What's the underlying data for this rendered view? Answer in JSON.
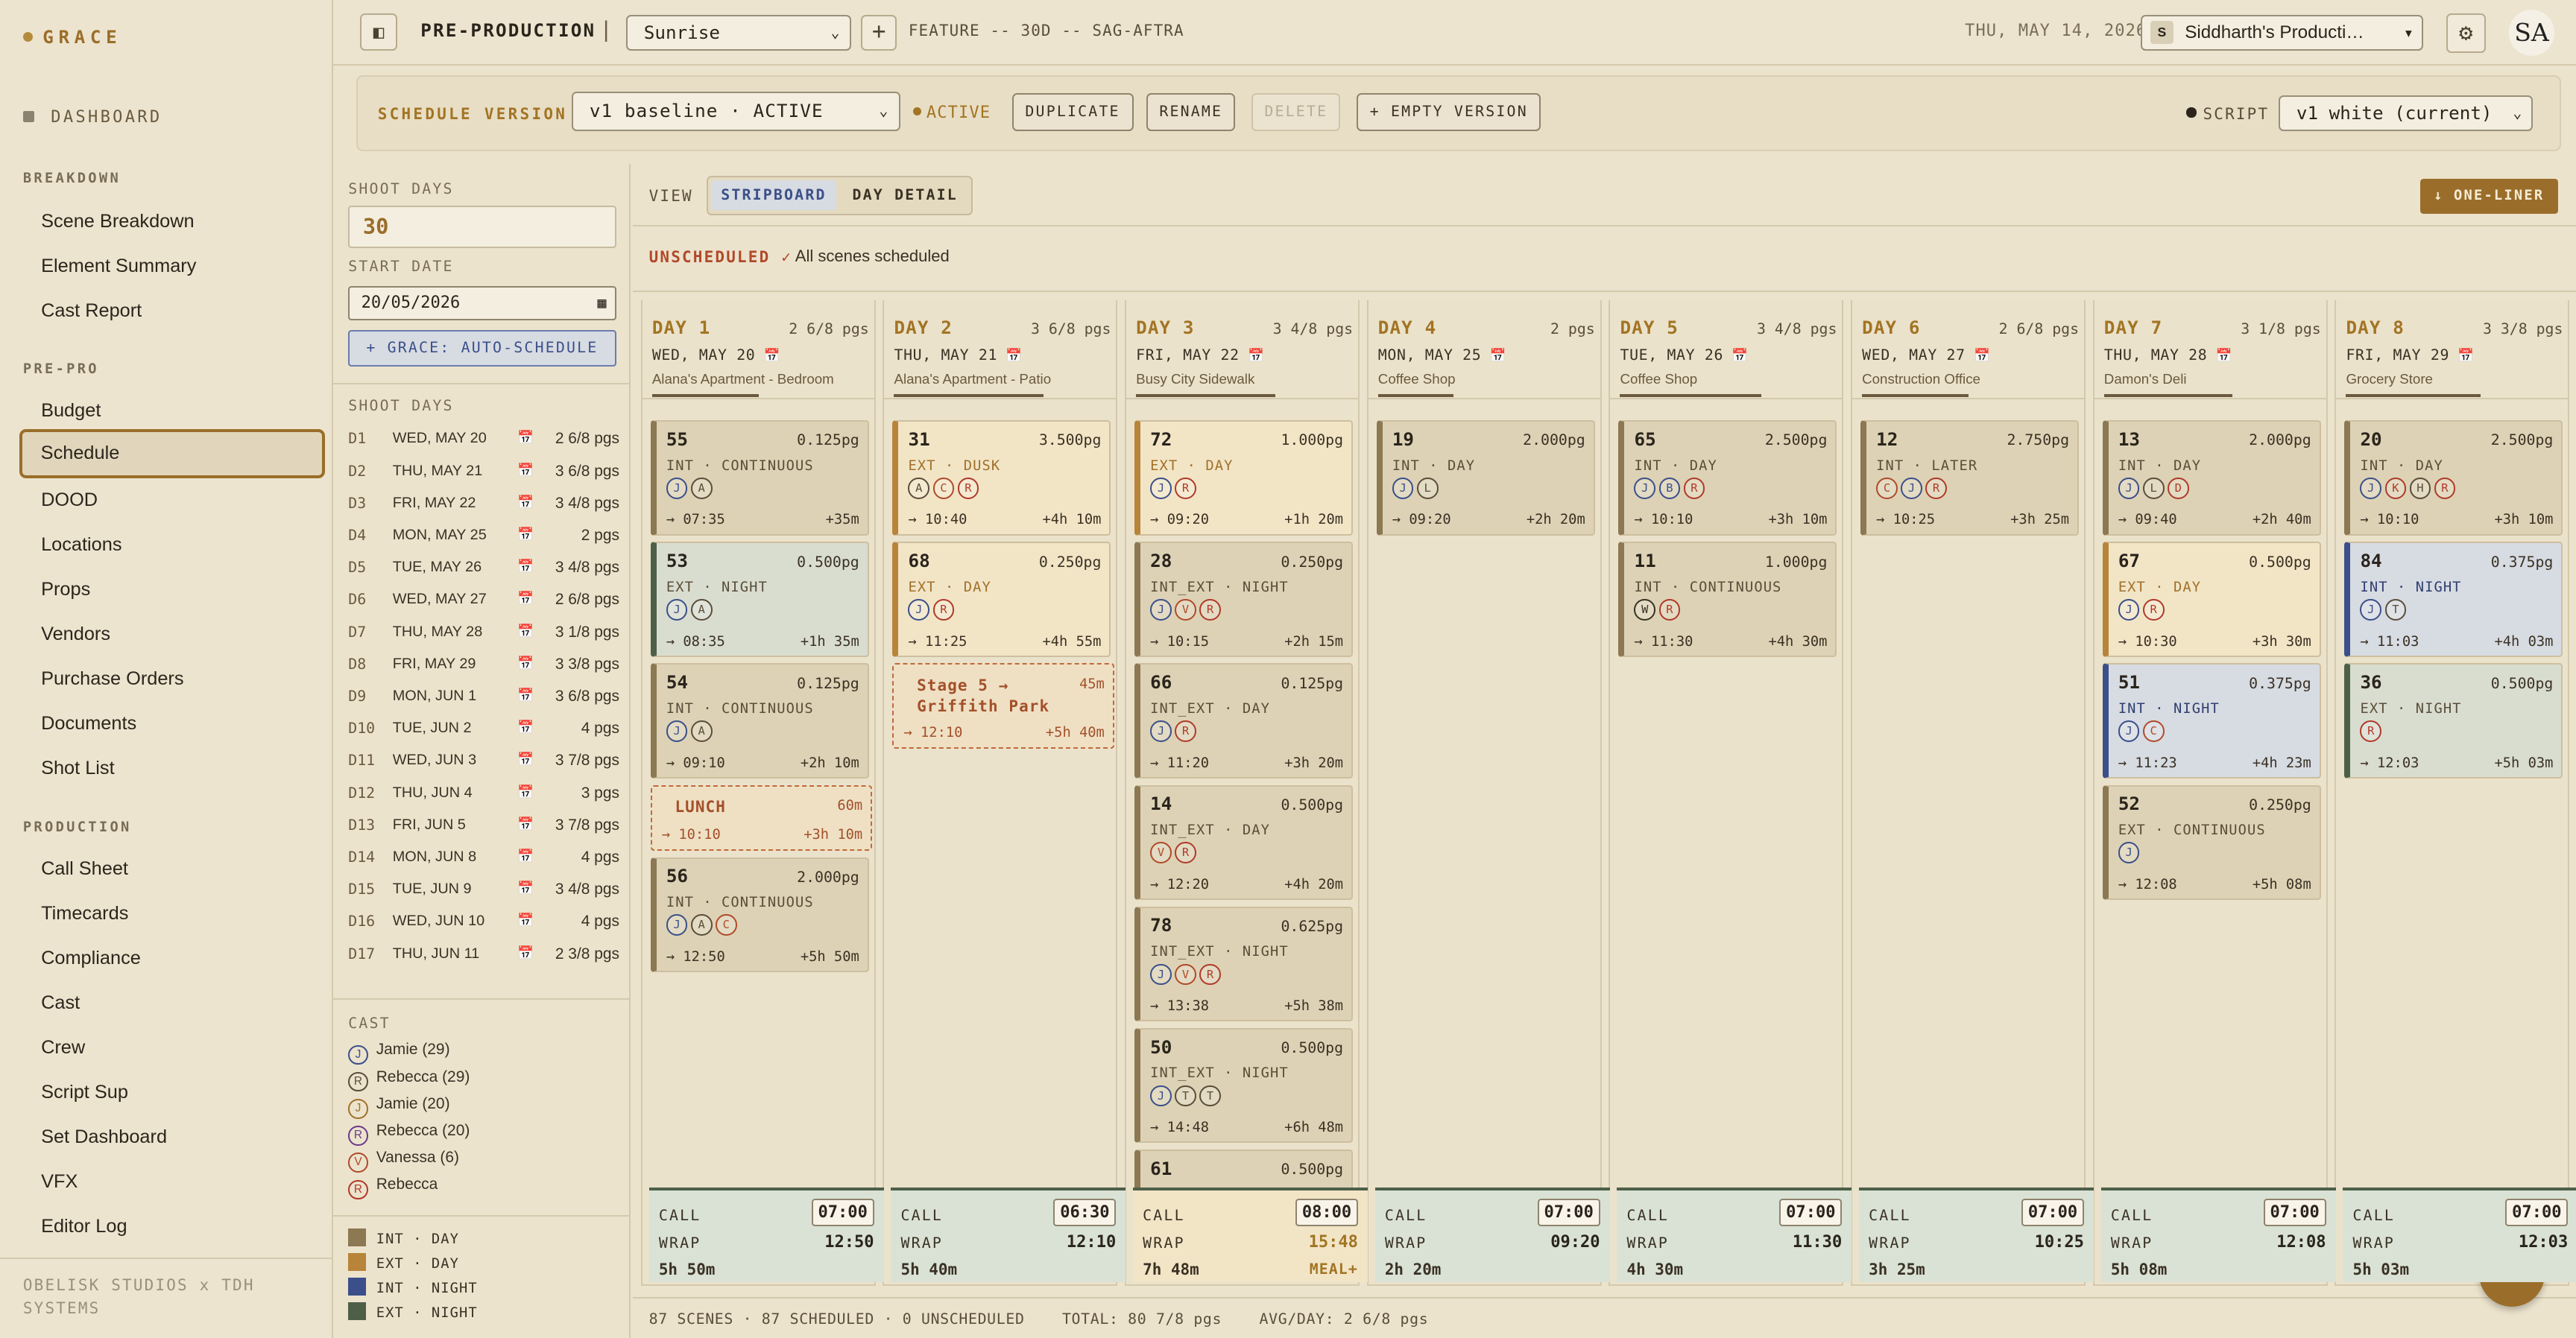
{
  "app": {
    "logo": "GRACE",
    "dashboard": "DASHBOARD",
    "footer": "OBELISK STUDIOS x TDH SYSTEMS"
  },
  "sidebar": {
    "breakdown_title": "BREAKDOWN",
    "breakdown": [
      "Scene Breakdown",
      "Element Summary",
      "Cast Report"
    ],
    "prepro_title": "PRE-PRO",
    "prepro": [
      "Budget",
      "Schedule",
      "DOOD",
      "Locations",
      "Props",
      "Vendors",
      "Purchase Orders",
      "Documents",
      "Shot List"
    ],
    "production_title": "PRODUCTION",
    "production": [
      "Call Sheet",
      "Timecards",
      "Compliance",
      "Cast",
      "Crew",
      "Script Sup",
      "Set Dashboard",
      "VFX",
      "Editor Log"
    ]
  },
  "topbar": {
    "section": "PRE-PRODUCTION",
    "project": "Sunrise",
    "feature": "FEATURE -- 30D -- SAG-AFTRA",
    "date": "THU, MAY 14, 2026",
    "production": "Siddharth's Producti…",
    "production_initial": "S",
    "user": "SA"
  },
  "version": {
    "label": "SCHEDULE VERSION",
    "value": "v1 baseline · ACTIVE",
    "status": "ACTIVE",
    "duplicate": "DUPLICATE",
    "rename": "RENAME",
    "delete": "DELETE",
    "empty": "+ EMPTY VERSION",
    "script_label": "SCRIPT",
    "script_value": "v1 white (current)"
  },
  "left": {
    "shoot_days_label": "SHOOT DAYS",
    "shoot_days": "30",
    "start_date_label": "START DATE",
    "start_date": "20/05/2026",
    "auto": "+ GRACE: AUTO-SCHEDULE",
    "list_title": "SHOOT DAYS",
    "cast_title": "CAST",
    "days": [
      [
        "D1",
        "WED, MAY 20",
        "2 6/8 pgs"
      ],
      [
        "D2",
        "THU, MAY 21",
        "3 6/8 pgs"
      ],
      [
        "D3",
        "FRI, MAY 22",
        "3 4/8 pgs"
      ],
      [
        "D4",
        "MON, MAY 25",
        "2 pgs"
      ],
      [
        "D5",
        "TUE, MAY 26",
        "3 4/8 pgs"
      ],
      [
        "D6",
        "WED, MAY 27",
        "2 6/8 pgs"
      ],
      [
        "D7",
        "THU, MAY 28",
        "3 1/8 pgs"
      ],
      [
        "D8",
        "FRI, MAY 29",
        "3 3/8 pgs"
      ],
      [
        "D9",
        "MON, JUN 1",
        "3 6/8 pgs"
      ],
      [
        "D10",
        "TUE, JUN 2",
        "4 pgs"
      ],
      [
        "D11",
        "WED, JUN 3",
        "3 7/8 pgs"
      ],
      [
        "D12",
        "THU, JUN 4",
        "3 pgs"
      ],
      [
        "D13",
        "FRI, JUN 5",
        "3 7/8 pgs"
      ],
      [
        "D14",
        "MON, JUN 8",
        "4 pgs"
      ],
      [
        "D15",
        "TUE, JUN 9",
        "3 4/8 pgs"
      ],
      [
        "D16",
        "WED, JUN 10",
        "4 pgs"
      ],
      [
        "D17",
        "THU, JUN 11",
        "2 3/8 pgs"
      ]
    ],
    "cast": [
      [
        "J",
        "Jamie (29)",
        "#3b4f8a"
      ],
      [
        "R",
        "Rebecca (29)",
        "#5a4e3a"
      ],
      [
        "J",
        "Jamie (20)",
        "#a0702a"
      ],
      [
        "R",
        "Rebecca (20)",
        "#6a3a8a"
      ],
      [
        "V",
        "Vanessa (6)",
        "#b04a2a"
      ],
      [
        "R",
        "Rebecca",
        "#b03a2a"
      ]
    ],
    "legend": [
      [
        "INT · DAY",
        "#8c7852"
      ],
      [
        "EXT · DAY",
        "#b8843a"
      ],
      [
        "INT · NIGHT",
        "#3b4f8a"
      ],
      [
        "EXT · NIGHT",
        "#4e5f48"
      ]
    ]
  },
  "main": {
    "view_label": "VIEW",
    "tab_strip": "STRIPBOARD",
    "tab_day": "DAY DETAIL",
    "oneliner": "↓ ONE-LINER",
    "unscheduled": "UNSCHEDULED ✓",
    "all_scheduled": "All scenes scheduled",
    "status": "87 SCENES · 87 SCHEDULED · 0 UNSCHEDULED    TOTAL: 80 7/8 pgs    AVG/DAY: 2 6/8 pgs"
  },
  "days": [
    {
      "title": "DAY 1",
      "pages": "2 6/8 pgs",
      "date": "WED, MAY 20",
      "loc": "Alana's Apartment - Bedroom",
      "call": "07:00",
      "wrap": "12:50",
      "dur": "5h 50m",
      "meal": "",
      "fill": 0.5,
      "items": [
        {
          "k": "card",
          "c": "intday",
          "n": "55",
          "pg": "0.125pg",
          "ty": "INT · CONTINUOUS",
          "cast": [
            "J",
            "A"
          ],
          "tm": "→ 07:35",
          "du": "+35m"
        },
        {
          "k": "card",
          "c": "extnight",
          "n": "53",
          "pg": "0.500pg",
          "ty": "EXT · NIGHT",
          "cast": [
            "J",
            "A"
          ],
          "tm": "→ 08:35",
          "du": "+1h 35m"
        },
        {
          "k": "card",
          "c": "intday",
          "n": "54",
          "pg": "0.125pg",
          "ty": "INT · CONTINUOUS",
          "cast": [
            "J",
            "A"
          ],
          "tm": "→ 09:10",
          "du": "+2h 10m"
        },
        {
          "k": "brk",
          "l": "LUNCH",
          "m": "60m",
          "tm": "→ 10:10",
          "du": "+3h 10m",
          "h": 40
        },
        {
          "k": "card",
          "c": "intday",
          "n": "56",
          "pg": "2.000pg",
          "ty": "INT · CONTINUOUS",
          "cast": [
            "J",
            "A",
            "C"
          ],
          "tm": "→ 12:50",
          "du": "+5h 50m"
        }
      ]
    },
    {
      "title": "DAY 2",
      "pages": "3 6/8 pgs",
      "date": "THU, MAY 21",
      "loc": "Alana's Apartment - Patio",
      "call": "06:30",
      "wrap": "12:10",
      "dur": "5h 40m",
      "meal": "",
      "fill": 0.7,
      "items": [
        {
          "k": "card",
          "c": "extday",
          "n": "31",
          "pg": "3.500pg",
          "ty": "EXT · DUSK",
          "cast": [
            "A",
            "C",
            "R"
          ],
          "tm": "→ 10:40",
          "du": "+4h 10m"
        },
        {
          "k": "card",
          "c": "extday",
          "n": "68",
          "pg": "0.250pg",
          "ty": "EXT · DAY",
          "cast": [
            "J",
            "R"
          ],
          "tm": "→ 11:25",
          "du": "+4h 55m"
        },
        {
          "k": "brk",
          "l": "Stage 5 → Griffith Park",
          "m": "45m",
          "tm": "→ 12:10",
          "du": "+5h 40m",
          "h": 52
        }
      ]
    },
    {
      "title": "DAY 3",
      "pages": "3 4/8 pgs",
      "date": "FRI, MAY 22",
      "loc": "Busy City Sidewalk",
      "call": "08:00",
      "wrap": "15:48",
      "dur": "7h 48m",
      "meal": "MEAL+",
      "fill": 0.65,
      "items": [
        {
          "k": "card",
          "c": "extday",
          "n": "72",
          "pg": "1.000pg",
          "ty": "EXT · DAY",
          "cast": [
            "J",
            "R"
          ],
          "tm": "→ 09:20",
          "du": "+1h 20m"
        },
        {
          "k": "card",
          "c": "intday",
          "n": "28",
          "pg": "0.250pg",
          "ty": "INT_EXT · NIGHT",
          "cast": [
            "J",
            "V",
            "R"
          ],
          "tm": "→ 10:15",
          "du": "+2h 15m"
        },
        {
          "k": "card",
          "c": "intday",
          "n": "66",
          "pg": "0.125pg",
          "ty": "INT_EXT · DAY",
          "cast": [
            "J",
            "R"
          ],
          "tm": "→ 11:20",
          "du": "+3h 20m"
        },
        {
          "k": "card",
          "c": "intday",
          "n": "14",
          "pg": "0.500pg",
          "ty": "INT_EXT · DAY",
          "cast": [
            "V",
            "R"
          ],
          "tm": "→ 12:20",
          "du": "+4h 20m"
        },
        {
          "k": "card",
          "c": "intday",
          "n": "78",
          "pg": "0.625pg",
          "ty": "INT_EXT · NIGHT",
          "cast": [
            "J",
            "V",
            "R"
          ],
          "tm": "→ 13:38",
          "du": "+5h 38m"
        },
        {
          "k": "card",
          "c": "intday",
          "n": "50",
          "pg": "0.500pg",
          "ty": "INT_EXT · NIGHT",
          "cast": [
            "J",
            "T",
            "T"
          ],
          "tm": "→ 14:48",
          "du": "+6h 48m"
        },
        {
          "k": "card",
          "c": "intday",
          "n": "61",
          "pg": "0.500pg",
          "ty": "",
          "cast": [],
          "tm": "",
          "du": ""
        }
      ]
    },
    {
      "title": "DAY 4",
      "pages": "2 pgs",
      "date": "MON, MAY 25",
      "loc": "Coffee Shop",
      "call": "07:00",
      "wrap": "09:20",
      "dur": "2h 20m",
      "meal": "",
      "fill": 0.35,
      "items": [
        {
          "k": "card",
          "c": "intday",
          "n": "19",
          "pg": "2.000pg",
          "ty": "INT · DAY",
          "cast": [
            "J",
            "L"
          ],
          "tm": "→ 09:20",
          "du": "+2h 20m"
        }
      ]
    },
    {
      "title": "DAY 5",
      "pages": "3 4/8 pgs",
      "date": "TUE, MAY 26",
      "loc": "Coffee Shop",
      "call": "07:00",
      "wrap": "11:30",
      "dur": "4h 30m",
      "meal": "",
      "fill": 0.66,
      "items": [
        {
          "k": "card",
          "c": "intday",
          "n": "65",
          "pg": "2.500pg",
          "ty": "INT · DAY",
          "cast": [
            "J",
            "B",
            "R"
          ],
          "tm": "→ 10:10",
          "du": "+3h 10m"
        },
        {
          "k": "card",
          "c": "intday",
          "n": "11",
          "pg": "1.000pg",
          "ty": "INT · CONTINUOUS",
          "cast": [
            "W",
            "R"
          ],
          "tm": "→ 11:30",
          "du": "+4h 30m"
        }
      ]
    },
    {
      "title": "DAY 6",
      "pages": "2 6/8 pgs",
      "date": "WED, MAY 27",
      "loc": "Construction Office",
      "call": "07:00",
      "wrap": "10:25",
      "dur": "3h 25m",
      "meal": "",
      "fill": 0.5,
      "items": [
        {
          "k": "card",
          "c": "intday",
          "n": "12",
          "pg": "2.750pg",
          "ty": "INT · LATER",
          "cast": [
            "C",
            "J",
            "R"
          ],
          "tm": "→ 10:25",
          "du": "+3h 25m"
        }
      ]
    },
    {
      "title": "DAY 7",
      "pages": "3 1/8 pgs",
      "date": "THU, MAY 28",
      "loc": "Damon's Deli",
      "call": "07:00",
      "wrap": "12:08",
      "dur": "5h 08m",
      "meal": "",
      "fill": 0.6,
      "items": [
        {
          "k": "card",
          "c": "intday",
          "n": "13",
          "pg": "2.000pg",
          "ty": "INT · DAY",
          "cast": [
            "J",
            "L",
            "D"
          ],
          "tm": "→ 09:40",
          "du": "+2h 40m"
        },
        {
          "k": "card",
          "c": "extday",
          "n": "67",
          "pg": "0.500pg",
          "ty": "EXT · DAY",
          "cast": [
            "J",
            "R"
          ],
          "tm": "→ 10:30",
          "du": "+3h 30m"
        },
        {
          "k": "card",
          "c": "intnight",
          "n": "51",
          "pg": "0.375pg",
          "ty": "INT · NIGHT",
          "cast": [
            "J",
            "C"
          ],
          "tm": "→ 11:23",
          "du": "+4h 23m"
        },
        {
          "k": "card",
          "c": "intday",
          "n": "52",
          "pg": "0.250pg",
          "ty": "EXT · CONTINUOUS",
          "cast": [
            "J"
          ],
          "tm": "→ 12:08",
          "du": "+5h 08m"
        }
      ]
    },
    {
      "title": "DAY 8",
      "pages": "3 3/8 pgs",
      "date": "FRI, MAY 29",
      "loc": "Grocery Store",
      "call": "07:00",
      "wrap": "12:03",
      "dur": "5h 03m",
      "meal": "",
      "fill": 0.63,
      "items": [
        {
          "k": "card",
          "c": "intday",
          "n": "20",
          "pg": "2.500pg",
          "ty": "INT · DAY",
          "cast": [
            "J",
            "K",
            "H",
            "R"
          ],
          "tm": "→ 10:10",
          "du": "+3h 10m"
        },
        {
          "k": "card",
          "c": "intnight",
          "n": "84",
          "pg": "0.375pg",
          "ty": "INT · NIGHT",
          "cast": [
            "J",
            "T"
          ],
          "tm": "→ 11:03",
          "du": "+4h 03m"
        },
        {
          "k": "card",
          "c": "extnight",
          "n": "36",
          "pg": "0.500pg",
          "ty": "EXT · NIGHT",
          "cast": [
            "R"
          ],
          "tm": "→ 12:03",
          "du": "+5h 03m"
        }
      ]
    }
  ],
  "labels": {
    "call": "CALL",
    "wrap": "WRAP"
  },
  "fab": "G"
}
